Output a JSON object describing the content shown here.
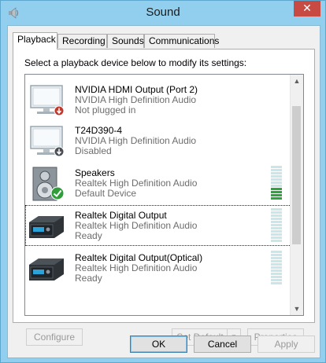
{
  "window": {
    "title": "Sound",
    "close_label": "✕"
  },
  "tabs": [
    {
      "label": "Playback",
      "active": true
    },
    {
      "label": "Recording",
      "active": false
    },
    {
      "label": "Sounds",
      "active": false
    },
    {
      "label": "Communications",
      "active": false
    }
  ],
  "instruction": "Select a playback device below to modify its settings:",
  "devices": [
    {
      "name": "NVIDIA HDMI Output (Port 2)",
      "driver": "NVIDIA High Definition Audio",
      "status": "Not plugged in",
      "icon": "monitor-icon",
      "badge": "unplugged-badge-icon",
      "meter": null
    },
    {
      "name": "T24D390-4",
      "driver": "NVIDIA High Definition Audio",
      "status": "Disabled",
      "icon": "monitor-icon",
      "badge": "disabled-badge-icon",
      "meter": null
    },
    {
      "name": "Speakers",
      "driver": "Realtek High Definition Audio",
      "status": "Default Device",
      "icon": "speaker-icon",
      "badge": "default-check-icon",
      "meter": {
        "level": 0.36
      }
    },
    {
      "name": "Realtek Digital Output",
      "driver": "Realtek High Definition Audio",
      "status": "Ready",
      "icon": "digital-output-icon",
      "badge": null,
      "meter": {
        "level": 0
      }
    },
    {
      "name": "Realtek Digital Output(Optical)",
      "driver": "Realtek High Definition Audio",
      "status": "Ready",
      "icon": "digital-output-icon",
      "badge": null,
      "meter": {
        "level": 0
      }
    }
  ],
  "buttons": {
    "configure": "Configure",
    "set_default": "Set Default",
    "properties": "Properties",
    "ok": "OK",
    "cancel": "Cancel",
    "apply": "Apply"
  },
  "colors": {
    "meter_on": "#2aa63a",
    "meter_off": "#c9e6e9",
    "window_frame": "#92cfee",
    "close_button": "#c74a43"
  }
}
